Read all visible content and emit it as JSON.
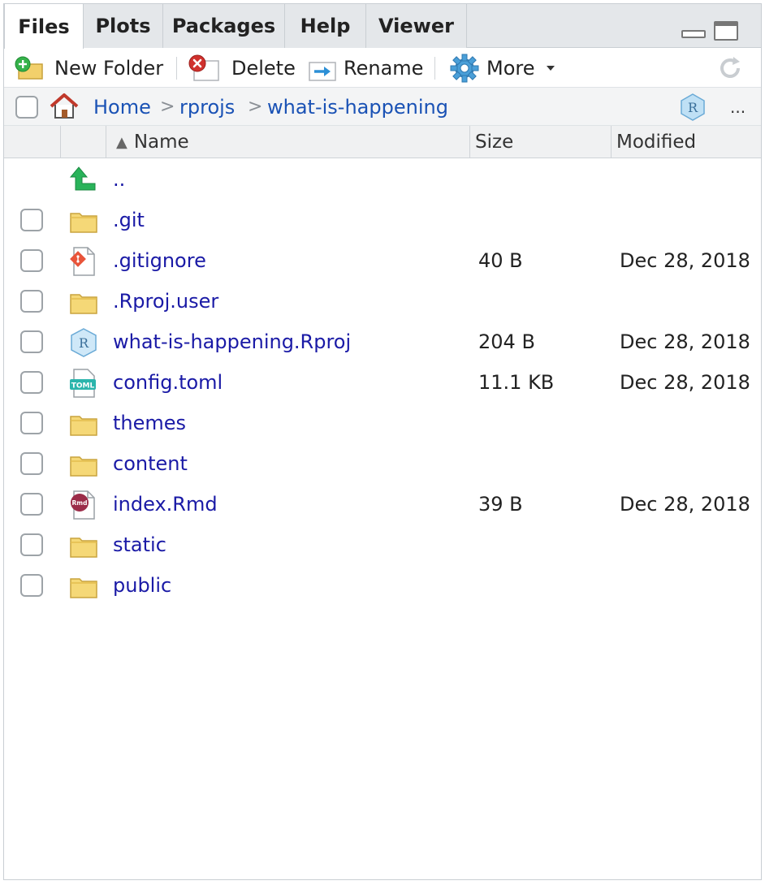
{
  "tabs": [
    {
      "label": "Files",
      "active": true
    },
    {
      "label": "Plots",
      "active": false
    },
    {
      "label": "Packages",
      "active": false
    },
    {
      "label": "Help",
      "active": false
    },
    {
      "label": "Viewer",
      "active": false
    }
  ],
  "toolbar": {
    "new_folder": "New Folder",
    "delete": "Delete",
    "rename": "Rename",
    "more": "More"
  },
  "breadcrumb": {
    "home": "Home",
    "items": [
      "rprojs",
      "what-is-happening"
    ],
    "separator": ">",
    "overflow": "..."
  },
  "columns": {
    "name": "Name",
    "size": "Size",
    "modified": "Modified",
    "sort_indicator": "▲"
  },
  "parent_dir": "..",
  "files": [
    {
      "name": ".git",
      "size": "",
      "modified": "",
      "icon": "folder-icon"
    },
    {
      "name": ".gitignore",
      "size": "40 B",
      "modified": "Dec 28, 2018",
      "icon": "git-file-icon"
    },
    {
      "name": ".Rproj.user",
      "size": "",
      "modified": "",
      "icon": "folder-icon"
    },
    {
      "name": "what-is-happening.Rproj",
      "size": "204 B",
      "modified": "Dec 28, 2018",
      "icon": "rproj-file-icon"
    },
    {
      "name": "config.toml",
      "size": "11.1 KB",
      "modified": "Dec 28, 2018",
      "icon": "toml-file-icon"
    },
    {
      "name": "themes",
      "size": "",
      "modified": "",
      "icon": "folder-icon"
    },
    {
      "name": "content",
      "size": "",
      "modified": "",
      "icon": "folder-icon"
    },
    {
      "name": "index.Rmd",
      "size": "39 B",
      "modified": "Dec 28, 2018",
      "icon": "rmd-file-icon"
    },
    {
      "name": "static",
      "size": "",
      "modified": "",
      "icon": "folder-icon"
    },
    {
      "name": "public",
      "size": "",
      "modified": "",
      "icon": "folder-icon"
    }
  ],
  "icon_labels": {
    "toml": "TOML",
    "rmd": "Rmd",
    "r": "R"
  },
  "colors": {
    "link": "#1a52b5",
    "filename": "#1a1aa6",
    "folder": "#f2d06b",
    "git": "#e8543a",
    "rmd": "#9b2c49",
    "toml": "#2bb5ac",
    "rproj": "#8fc6e8"
  }
}
